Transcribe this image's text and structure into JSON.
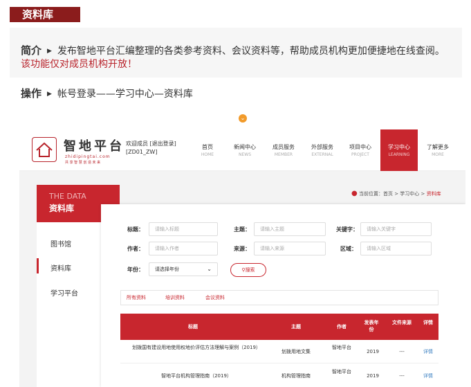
{
  "banner": {
    "title": "资料库"
  },
  "intro": {
    "intro_label": "简介",
    "intro_text": "发布智地平台汇编整理的各类参考资料、会议资料等，帮助成员机构更加便捷地在线查阅。",
    "intro_note": "该功能仅对成员机构开放！",
    "op_label": "操作",
    "op_text": "帐号登录——学习中心—资料库"
  },
  "site": {
    "logo_title": "智地平台",
    "logo_domain": "zhidipingtai.com",
    "logo_slogan": "共 享 智 慧 创 造 未 来",
    "welcome_line1": "欢迎成员 [退出登录]",
    "welcome_line2": "[ZD01_ZW]",
    "nav": [
      {
        "label": "首页",
        "sub": "HOME"
      },
      {
        "label": "新闻中心",
        "sub": "NEWS"
      },
      {
        "label": "成员服务",
        "sub": "MEMBER"
      },
      {
        "label": "外部服务",
        "sub": "EXTERNAL"
      },
      {
        "label": "项目中心",
        "sub": "PROJECT"
      },
      {
        "label": "学习中心",
        "sub": "LEARNING"
      },
      {
        "label": "了解更多",
        "sub": "MORE"
      }
    ]
  },
  "sidebar": {
    "en_title": "THE DATA",
    "cn_title": "资料库",
    "items": [
      "图书馆",
      "资料库",
      "学习平台"
    ]
  },
  "breadcrumb": "当前位置：首页 > 学习中心 > ",
  "breadcrumb_current": "资料库",
  "form": {
    "title_label": "标题：",
    "title_ph": "请输入标题",
    "subject_label": "主题：",
    "subject_ph": "请输入主题",
    "keyword_label": "关键字：",
    "keyword_ph": "请输入关键字",
    "author_label": "作者：",
    "author_ph": "请输入作者",
    "source_label": "来源：",
    "source_ph": "请输入来源",
    "region_label": "区域：",
    "region_ph": "请输入区域",
    "year_label": "年份：",
    "year_value": "请选择年份",
    "search_btn": "搜索"
  },
  "tabs": [
    "所有资料",
    "培训资料",
    "会议资料"
  ],
  "table": {
    "headers": [
      "标题",
      "主题",
      "作者",
      "发表年份",
      "文件来源",
      "详情"
    ],
    "rows": [
      {
        "title": "划拨国有建设用地使用权地价评估方法理解与案例（2019）",
        "subject": "划拨用地文集",
        "author": "智地平台",
        "year": "2019",
        "source": "---",
        "detail": "详情"
      },
      {
        "title": "智地平台机构管理指南（2019）",
        "subject": "机构管理指南",
        "author": "智地平台",
        "year": "2019",
        "source": "---",
        "detail": "详情"
      }
    ]
  }
}
